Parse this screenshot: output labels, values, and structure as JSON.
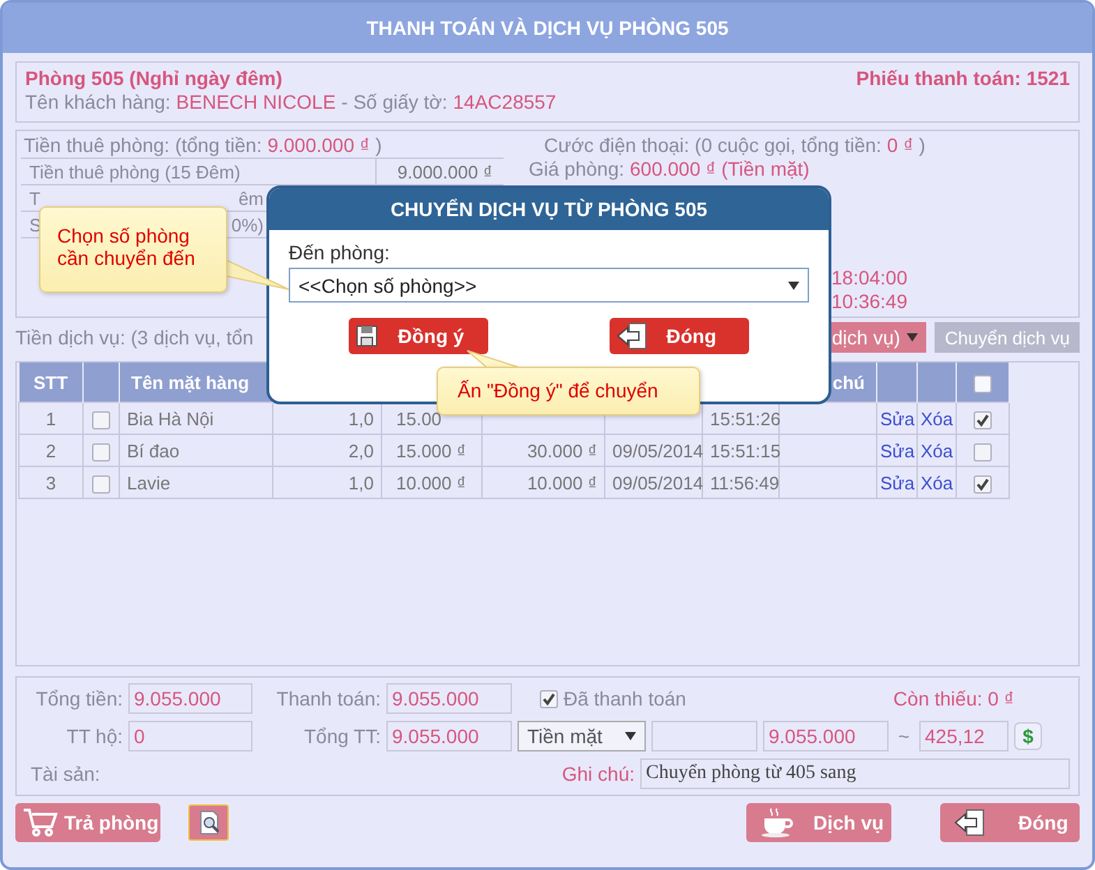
{
  "window": {
    "title": "THANH TOÁN VÀ DỊCH VỤ PHÒNG 505"
  },
  "room": {
    "title": "Phòng 505 (Nghỉ ngày đêm)",
    "receipt": "Phiếu thanh toán: 1521",
    "customer_label": "Tên khách hàng:",
    "customer_name": "BENECH NICOLE",
    "id_label": "- Số giấy tờ:",
    "id_value": "14AC28557"
  },
  "rent": {
    "label": "Tiền thuê phòng: (tổng tiền:",
    "total": "9.000.000 ₫",
    "close": ")",
    "rows": [
      {
        "start": "Tiền thuê phòng (15 Đêm)",
        "amount": "9.000.000 ₫"
      },
      {
        "start": "T",
        "end": "êm"
      },
      {
        "start": "S",
        "end": "0%)"
      }
    ]
  },
  "phone": {
    "label": "Cước điện thoại: (0 cuộc gọi, tổng tiền:",
    "total": "0 ₫",
    "close": ")",
    "price_label": "Giá phòng:",
    "price": "600.000 ₫ (Tiền mặt)",
    "times": [
      "18:04:00",
      "10:36:49"
    ]
  },
  "services": {
    "label": "Tiền dịch vụ: (3 dịch vụ, tổn",
    "filter": "dịch vụ)",
    "transfer_button": "Chuyển dịch vụ"
  },
  "table": {
    "columns": [
      {
        "kind": "text",
        "label": "STT"
      },
      {
        "kind": "blank"
      },
      {
        "kind": "text",
        "label": "Tên mặt hàng"
      },
      {
        "kind": "blank"
      },
      {
        "kind": "blank"
      },
      {
        "kind": "blank"
      },
      {
        "kind": "blank"
      },
      {
        "kind": "blank"
      },
      {
        "kind": "text",
        "label": "chú"
      },
      {
        "kind": "blank"
      },
      {
        "kind": "blank"
      },
      {
        "kind": "checkbox",
        "checked": false
      }
    ],
    "rows": [
      {
        "stt": "1",
        "checked": false,
        "name": "Bia Hà Nội",
        "qty": "1,0",
        "price": "15.00",
        "time": "15:51:26",
        "edit": "Sửa",
        "delete": "Xóa",
        "included": true
      },
      {
        "stt": "2",
        "checked": false,
        "name": "Bí đao",
        "qty": "2,0",
        "price": "15.000 ₫",
        "total": "30.000 ₫",
        "date": "09/05/2014",
        "time": "15:51:15",
        "edit": "Sửa",
        "delete": "Xóa",
        "included": false
      },
      {
        "stt": "3",
        "checked": false,
        "name": "Lavie",
        "qty": "1,0",
        "price": "10.000 ₫",
        "total": "10.000 ₫",
        "date": "09/05/2014",
        "time": "11:56:49",
        "edit": "Sửa",
        "delete": "Xóa",
        "included": true
      }
    ]
  },
  "footer": {
    "total_label": "Tổng tiền:",
    "total": "9.055.000",
    "pay_label": "Thanh toán:",
    "pay": "9.055.000",
    "paid_label": "Đã thanh toán",
    "paid": true,
    "owed": "Còn thiếu: 0 ₫",
    "proxy_label": "TT hộ:",
    "proxy": "0",
    "sum_label": "Tổng TT:",
    "sum": "9.055.000",
    "method": "Tiền mặt",
    "amount": "9.055.000",
    "tilde": "~",
    "converted": "425,12",
    "currency_button": "$",
    "asset_label": "Tài sản:",
    "note_label": "Ghi chú:",
    "note": "Chuyển phòng từ 405 sang"
  },
  "buttons": [
    {
      "kind": "checkout",
      "label": "Trả phòng"
    },
    {
      "kind": "preview"
    },
    {
      "kind": "service",
      "label": "Dịch vụ"
    },
    {
      "kind": "close",
      "label": "Đóng"
    }
  ],
  "modal": {
    "title": "CHUYỂN DỊCH VỤ TỪ PHÒNG 505",
    "field_label": "Đến phòng:",
    "select": "<<Chọn số phòng>>",
    "buttons": [
      {
        "kind": "save",
        "label": "Đồng ý"
      },
      {
        "kind": "close",
        "label": "Đóng"
      }
    ]
  },
  "callouts": [
    {
      "text": "Chọn số phòng cần chuyển đến"
    },
    {
      "text": "Ấn \"Đồng ý\" để chuyển"
    }
  ]
}
